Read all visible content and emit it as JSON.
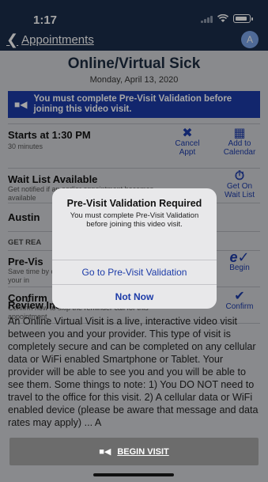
{
  "status": {
    "time": "1:17"
  },
  "nav": {
    "back_label": "Appointments",
    "avatar_initial": "A"
  },
  "header": {
    "title": "Online/Virtual Sick",
    "date": "Monday, April 13, 2020"
  },
  "banner": {
    "text": "You must complete Pre-Visit Validation before joining this video visit."
  },
  "appointment": {
    "starts_label": "Starts at 1:30 PM",
    "duration": "30 minutes",
    "cancel_label": "Cancel Appt",
    "calendar_label": "Add to Calendar"
  },
  "waitlist": {
    "title": "Wait List Available",
    "subtitle": "Get notified if an earlier appointment becomes available",
    "action_label": "Get On Wait List"
  },
  "provider": {
    "name": "Austin"
  },
  "get_ready": {
    "heading": "GET REA"
  },
  "previsit": {
    "title": "Pre-Vis",
    "subtitle": "Save time by completing pre-visit steps ahead of your in",
    "action_label": "Begin"
  },
  "confirm": {
    "title": "Confirm",
    "subtitle": "Confirm now to skip the reminder call for this appointment.",
    "action_label": "Confirm"
  },
  "review": {
    "title": "Review Instructions",
    "body": "An Online Virtual Visit is a live, interactive video visit between you and your provider. This type of visit is completely secure and can be completed on any cellular data or WiFi enabled Smartphone or Tablet. Your provider will be able to see you and you will be able to see them.  Some things to note: 1) You DO NOT need to travel to the office for this visit. 2) A cellular data or WiFi enabled device (please be aware that message and data rates may apply) ... A"
  },
  "dialog": {
    "title": "Pre-Visit Validation Required",
    "message": "You must complete Pre-Visit Validation before joining this video visit.",
    "primary_label": "Go to Pre-Visit Validation",
    "secondary_label": "Not Now"
  },
  "begin_visit": {
    "label": "BEGIN VISIT"
  },
  "colors": {
    "navy": "#1b2d4b",
    "accent_blue": "#1c3ba8",
    "banner_blue": "#1c3ba8"
  }
}
